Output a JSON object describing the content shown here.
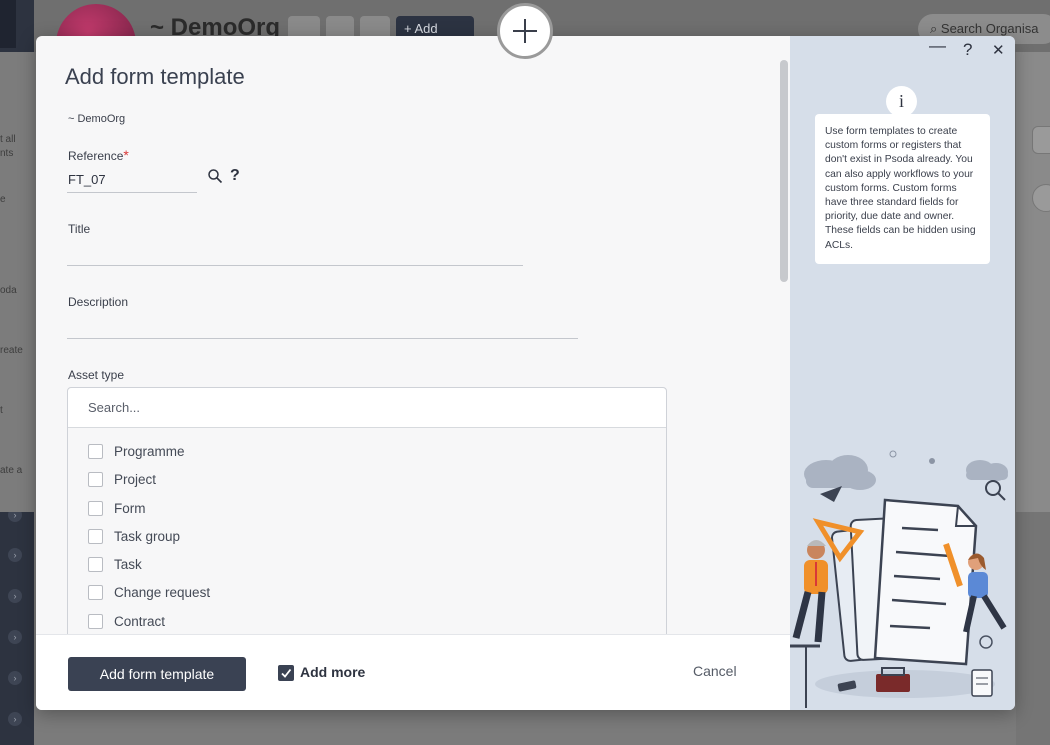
{
  "background": {
    "org_title": "~ DemoOrg",
    "add_button": "Add",
    "search_placeholder": "Search Organisa",
    "side_texts": [
      "t all",
      "nts",
      "e",
      "oda",
      "reate",
      "t",
      "ate a"
    ]
  },
  "modal": {
    "title": "Add form template",
    "org": "~ DemoOrg",
    "reference": {
      "label": "Reference",
      "required_mark": "*",
      "value": "FT_07",
      "help": "?"
    },
    "title_field": {
      "label": "Title",
      "value": ""
    },
    "description_field": {
      "label": "Description",
      "value": ""
    },
    "asset_type": {
      "label": "Asset type",
      "search_placeholder": "Search...",
      "options": [
        "Programme",
        "Project",
        "Form",
        "Task group",
        "Task",
        "Change request",
        "Contract"
      ]
    },
    "footer": {
      "submit_label": "Add form template",
      "add_more_label": "Add more",
      "add_more_checked": true,
      "cancel_label": "Cancel"
    },
    "window_controls": {
      "minimize": "—",
      "help": "?",
      "close": "✕"
    },
    "info": {
      "icon": "i",
      "text": "Use form templates to create custom forms or registers that don't exist in Psoda already. You can also apply workflows to your custom forms. Custom forms have three standard fields for priority, due date and owner. These fields can be hidden using ACLs."
    }
  },
  "colors": {
    "primary": "#3a4253",
    "panel": "#d6dee9",
    "required": "#d93838",
    "accent_orange": "#f0902a"
  }
}
